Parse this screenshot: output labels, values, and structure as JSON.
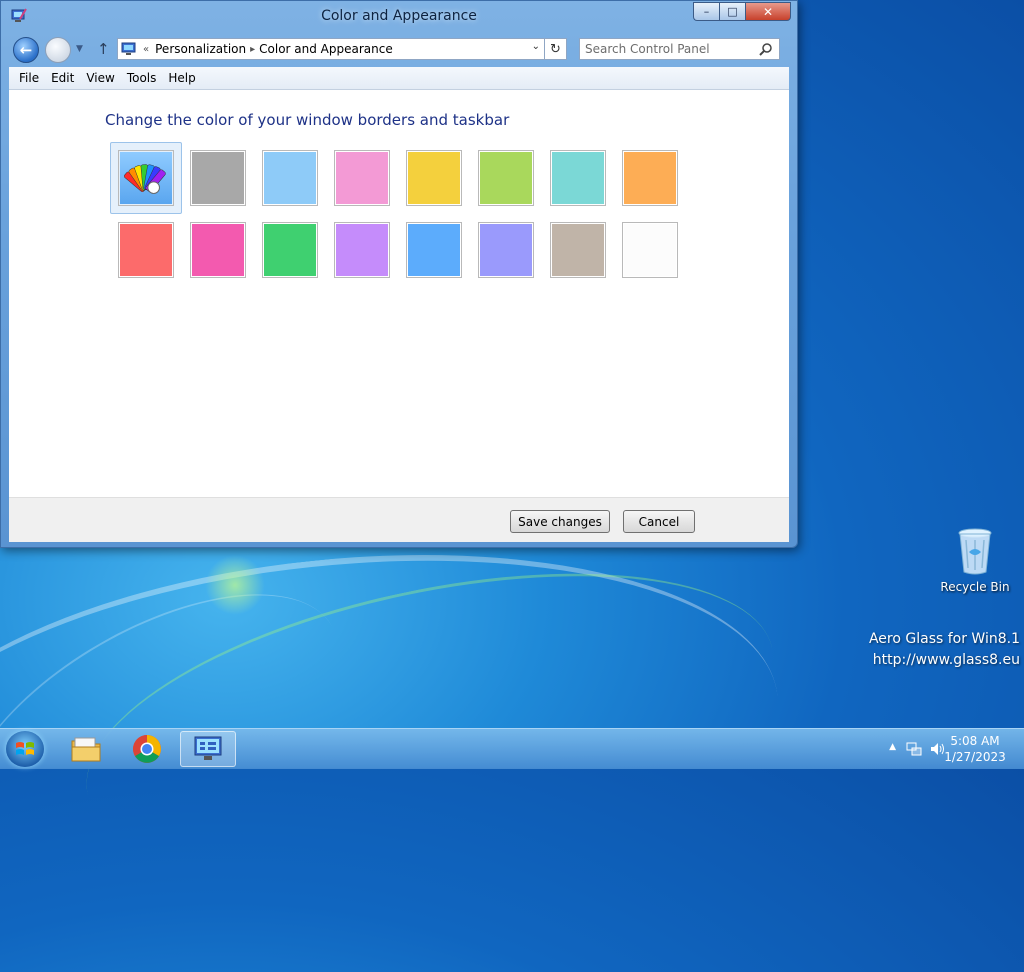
{
  "window": {
    "title": "Color and Appearance",
    "controls": {
      "minimize": "–",
      "maximize": "□",
      "close": "✕"
    }
  },
  "navigation": {
    "overflow_chevron": "«",
    "breadcrumb": [
      "Personalization",
      "Color and Appearance"
    ],
    "search_placeholder": "Search Control Panel"
  },
  "menu": [
    "File",
    "Edit",
    "View",
    "Tools",
    "Help"
  ],
  "content": {
    "heading": "Change the color of your window borders and taskbar",
    "swatches_row1": [
      {
        "name": "automatic",
        "color": "custom-palette-icon",
        "selected": true
      },
      {
        "name": "slate",
        "color": "#a8a8a8"
      },
      {
        "name": "sky",
        "color": "#8ecbf8"
      },
      {
        "name": "pink",
        "color": "#f39ad5"
      },
      {
        "name": "yellow",
        "color": "#f4d03d"
      },
      {
        "name": "lime",
        "color": "#a9d85c"
      },
      {
        "name": "teal",
        "color": "#7bd8d6"
      },
      {
        "name": "orange",
        "color": "#fdad55"
      }
    ],
    "swatches_row2": [
      {
        "name": "red",
        "color": "#fc6b6b"
      },
      {
        "name": "magenta",
        "color": "#f35aaf"
      },
      {
        "name": "green",
        "color": "#3fd070"
      },
      {
        "name": "violet",
        "color": "#c58cfb"
      },
      {
        "name": "blue",
        "color": "#5cacfc"
      },
      {
        "name": "periwinkle",
        "color": "#9a9afc"
      },
      {
        "name": "taupe",
        "color": "#c0b4a8"
      },
      {
        "name": "white",
        "color": "#fcfcfc"
      }
    ]
  },
  "buttons": {
    "save": "Save changes",
    "cancel": "Cancel"
  },
  "desktop": {
    "recycle_bin": "Recycle Bin",
    "watermark_line1": "Aero Glass for Win8.1",
    "watermark_line2": "http://www.glass8.eu"
  },
  "taskbar": {
    "apps": [
      "file-explorer-icon",
      "chrome-icon",
      "control-panel-icon"
    ],
    "time": "5:08 AM",
    "date": "1/27/2023"
  }
}
